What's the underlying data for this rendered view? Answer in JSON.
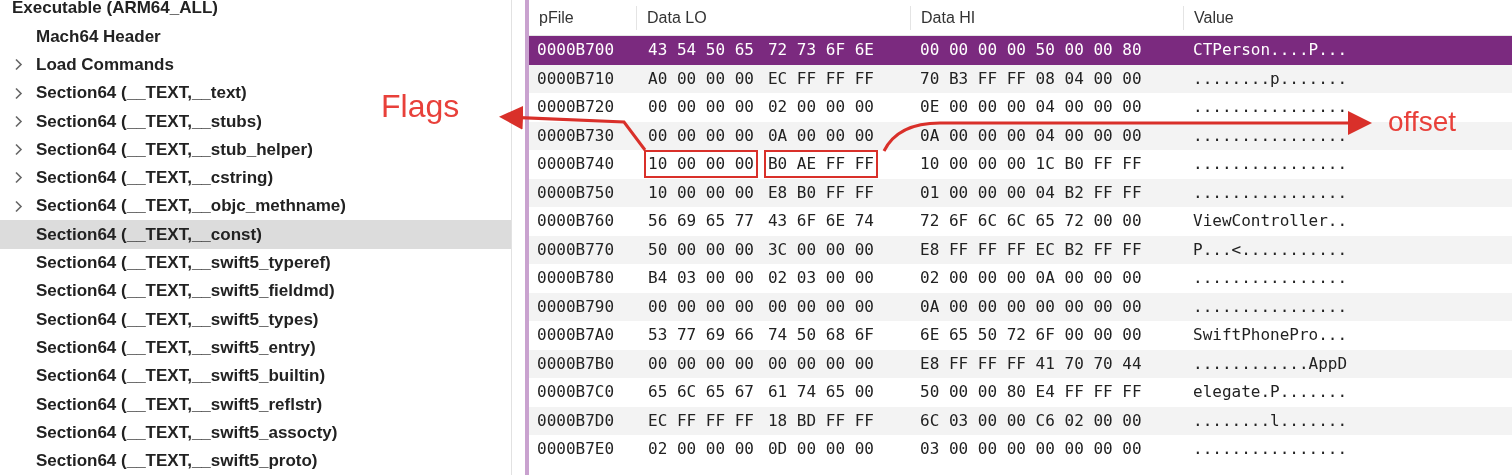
{
  "tree": {
    "label": "Executable  (ARM64_ALL)",
    "expanded": true,
    "children": [
      {
        "label": "Mach64 Header",
        "kind": "leaf",
        "selected": false
      },
      {
        "label": "Load Commands",
        "kind": "group",
        "selected": false
      },
      {
        "label": "Section64 (__TEXT,__text)",
        "kind": "group",
        "selected": false
      },
      {
        "label": "Section64 (__TEXT,__stubs)",
        "kind": "group",
        "selected": false
      },
      {
        "label": "Section64 (__TEXT,__stub_helper)",
        "kind": "group",
        "selected": false
      },
      {
        "label": "Section64 (__TEXT,__cstring)",
        "kind": "group",
        "selected": false
      },
      {
        "label": "Section64 (__TEXT,__objc_methname)",
        "kind": "group",
        "selected": false
      },
      {
        "label": "Section64 (__TEXT,__const)",
        "kind": "leaf",
        "selected": true
      },
      {
        "label": "Section64 (__TEXT,__swift5_typeref)",
        "kind": "leaf",
        "selected": false
      },
      {
        "label": "Section64 (__TEXT,__swift5_fieldmd)",
        "kind": "leaf",
        "selected": false
      },
      {
        "label": "Section64 (__TEXT,__swift5_types)",
        "kind": "leaf",
        "selected": false
      },
      {
        "label": "Section64 (__TEXT,__swift5_entry)",
        "kind": "leaf",
        "selected": false
      },
      {
        "label": "Section64 (__TEXT,__swift5_builtin)",
        "kind": "leaf",
        "selected": false
      },
      {
        "label": "Section64 (__TEXT,__swift5_reflstr)",
        "kind": "leaf",
        "selected": false
      },
      {
        "label": "Section64 (__TEXT,__swift5_assocty)",
        "kind": "leaf",
        "selected": false
      },
      {
        "label": "Section64 (__TEXT,__swift5_proto)",
        "kind": "leaf",
        "selected": false
      }
    ]
  },
  "table": {
    "columns": [
      "pFile",
      "Data LO",
      "Data HI",
      "Value"
    ],
    "rows": [
      {
        "pfile": "0000B700",
        "lo": [
          "43 54 50 65",
          "72 73 6F 6E"
        ],
        "hi": "00 00 00 00 50 00 00 80",
        "value": "CTPerson....P...",
        "selected": true,
        "boxed": false
      },
      {
        "pfile": "0000B710",
        "lo": [
          "A0 00 00 00",
          "EC FF FF FF"
        ],
        "hi": "70 B3 FF FF 08 04 00 00",
        "value": "........p.......",
        "selected": false,
        "boxed": false
      },
      {
        "pfile": "0000B720",
        "lo": [
          "00 00 00 00",
          "02 00 00 00"
        ],
        "hi": "0E 00 00 00 04 00 00 00",
        "value": "................",
        "selected": false,
        "boxed": false
      },
      {
        "pfile": "0000B730",
        "lo": [
          "00 00 00 00",
          "0A 00 00 00"
        ],
        "hi": "0A 00 00 00 04 00 00 00",
        "value": "................",
        "selected": false,
        "boxed": false
      },
      {
        "pfile": "0000B740",
        "lo": [
          "10 00 00 00",
          "B0 AE FF FF"
        ],
        "hi": "10 00 00 00 1C B0 FF FF",
        "value": "................",
        "selected": false,
        "boxed": true
      },
      {
        "pfile": "0000B750",
        "lo": [
          "10 00 00 00",
          "E8 B0 FF FF"
        ],
        "hi": "01 00 00 00 04 B2 FF FF",
        "value": "................",
        "selected": false,
        "boxed": false
      },
      {
        "pfile": "0000B760",
        "lo": [
          "56 69 65 77",
          "43 6F 6E 74"
        ],
        "hi": "72 6F 6C 6C 65 72 00 00",
        "value": "ViewController..",
        "selected": false,
        "boxed": false
      },
      {
        "pfile": "0000B770",
        "lo": [
          "50 00 00 00",
          "3C 00 00 00"
        ],
        "hi": "E8 FF FF FF EC B2 FF FF",
        "value": "P...<...........",
        "selected": false,
        "boxed": false
      },
      {
        "pfile": "0000B780",
        "lo": [
          "B4 03 00 00",
          "02 03 00 00"
        ],
        "hi": "02 00 00 00 0A 00 00 00",
        "value": "................",
        "selected": false,
        "boxed": false
      },
      {
        "pfile": "0000B790",
        "lo": [
          "00 00 00 00",
          "00 00 00 00"
        ],
        "hi": "0A 00 00 00 00 00 00 00",
        "value": "................",
        "selected": false,
        "boxed": false
      },
      {
        "pfile": "0000B7A0",
        "lo": [
          "53 77 69 66",
          "74 50 68 6F"
        ],
        "hi": "6E 65 50 72 6F 00 00 00",
        "value": "SwiftPhonePro...",
        "selected": false,
        "boxed": false
      },
      {
        "pfile": "0000B7B0",
        "lo": [
          "00 00 00 00",
          "00 00 00 00"
        ],
        "hi": "E8 FF FF FF 41 70 70 44",
        "value": "............AppD",
        "selected": false,
        "boxed": false
      },
      {
        "pfile": "0000B7C0",
        "lo": [
          "65 6C 65 67",
          "61 74 65 00"
        ],
        "hi": "50 00 00 80 E4 FF FF FF",
        "value": "elegate.P.......",
        "selected": false,
        "boxed": false
      },
      {
        "pfile": "0000B7D0",
        "lo": [
          "EC FF FF FF",
          "18 BD FF FF"
        ],
        "hi": "6C 03 00 00 C6 02 00 00",
        "value": "........l.......",
        "selected": false,
        "boxed": false
      },
      {
        "pfile": "0000B7E0",
        "lo": [
          "02 00 00 00",
          "0D 00 00 00"
        ],
        "hi": "03 00 00 00 00 00 00 00",
        "value": "................",
        "selected": false,
        "boxed": false
      }
    ]
  },
  "annotations": [
    {
      "text": "Flags"
    },
    {
      "text": "offset"
    }
  ]
}
